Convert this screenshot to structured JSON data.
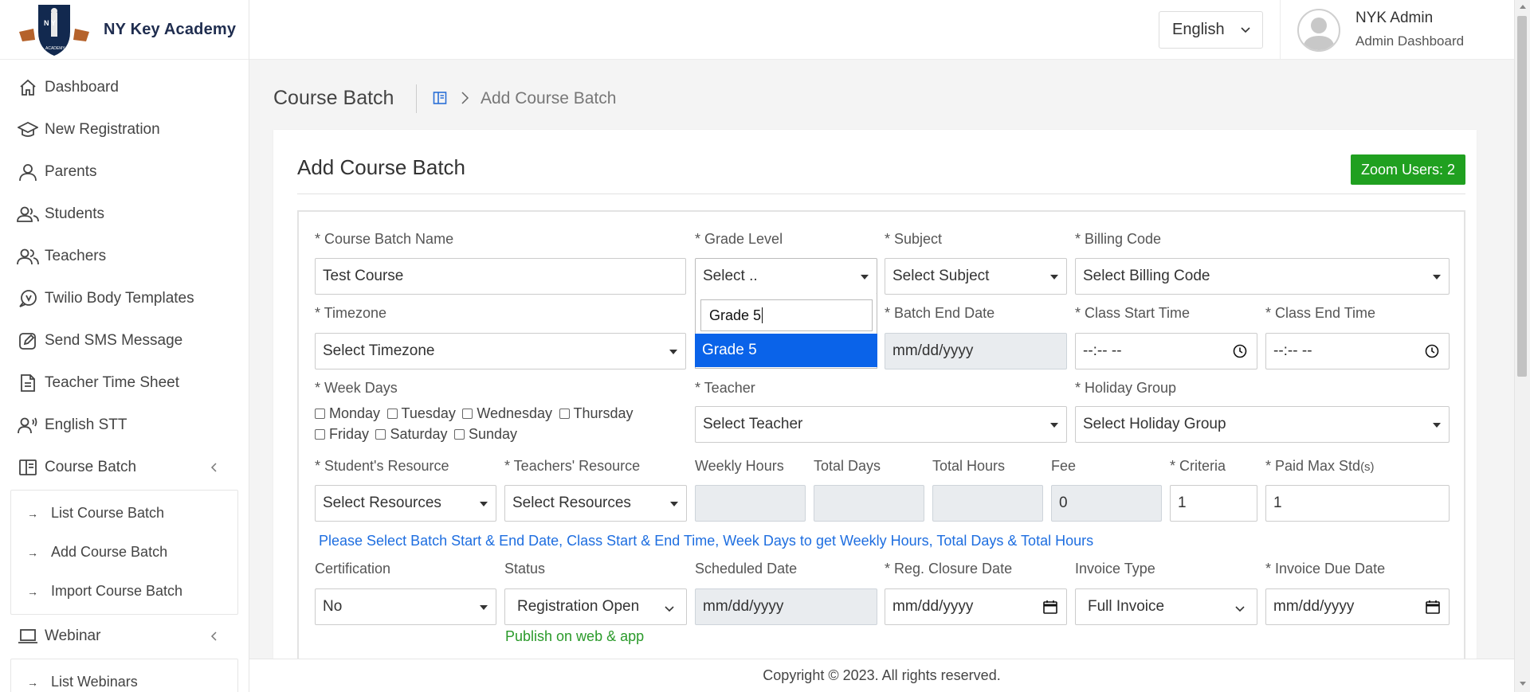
{
  "brand": {
    "name": "NY Key Academy",
    "logo_letters": "N Y",
    "logo_ribbon": "ACADEMY"
  },
  "sidebar": {
    "items": [
      {
        "label": "Dashboard",
        "icon": "home-icon"
      },
      {
        "label": "New Registration",
        "icon": "graduation-cap-icon"
      },
      {
        "label": "Parents",
        "icon": "user-icon"
      },
      {
        "label": "Students",
        "icon": "users-icon"
      },
      {
        "label": "Teachers",
        "icon": "users-icon"
      },
      {
        "label": "Twilio Body Templates",
        "icon": "chat-bubble-icon"
      },
      {
        "label": "Send SMS Message",
        "icon": "edit-icon"
      },
      {
        "label": "Teacher Time Sheet",
        "icon": "document-icon"
      },
      {
        "label": "English STT",
        "icon": "speaking-user-icon"
      },
      {
        "label": "Course Batch",
        "icon": "book-icon"
      }
    ],
    "course_batch_sub": [
      "List Course Batch",
      "Add Course Batch",
      "Import Course Batch"
    ],
    "webinar": {
      "label": "Webinar",
      "icon": "laptop-icon"
    },
    "webinar_sub": [
      "List Webinars"
    ]
  },
  "topbar": {
    "language": "English",
    "user_name": "NYK Admin",
    "user_role": "Admin Dashboard"
  },
  "breadcrumb": {
    "title": "Course Batch",
    "current": "Add Course Batch"
  },
  "card": {
    "title": "Add Course Batch",
    "zoom_badge": "Zoom Users: 2"
  },
  "form": {
    "labels": {
      "batch_name": "* Course Batch Name",
      "grade_level": "* Grade Level",
      "subject": "* Subject",
      "billing_code": "* Billing Code",
      "timezone": "* Timezone",
      "batch_end_date": "* Batch End Date",
      "class_start_time": "* Class Start Time",
      "class_end_time": "* Class End Time",
      "week_days": "* Week Days",
      "teacher": "* Teacher",
      "holiday_group": "* Holiday Group",
      "students_resource": "* Student's Resource",
      "teachers_resource": "* Teachers' Resource",
      "weekly_hours": "Weekly Hours",
      "total_days": "Total Days",
      "total_hours": "Total Hours",
      "fee": "Fee",
      "criteria": "* Criteria",
      "paid_max_std": "* Paid Max Std",
      "paid_max_std_suffix": "(s)",
      "certification": "Certification",
      "status": "Status",
      "scheduled_date": "Scheduled Date",
      "reg_closure_date": "* Reg. Closure Date",
      "invoice_type": "Invoice Type",
      "invoice_due_date": "* Invoice Due Date"
    },
    "values": {
      "batch_name": "Test Course",
      "grade_level": "Select ..",
      "grade_search": "Grade 5",
      "grade_option": "Grade 5",
      "subject": "Select Subject",
      "billing_code": "Select Billing Code",
      "timezone": "Select Timezone",
      "batch_end_date": "mm/dd/yyyy",
      "class_start_time": "--:-- --",
      "class_end_time": "--:-- --",
      "teacher": "Select Teacher",
      "holiday_group": "Select Holiday Group",
      "students_resource": "Select Resources",
      "teachers_resource": "Select Resources",
      "weekly_hours": "",
      "total_days": "",
      "total_hours": "",
      "fee": "0",
      "criteria": "1",
      "paid_max_std": "1",
      "certification": "No",
      "status": "Registration Open",
      "scheduled_date": "mm/dd/yyyy",
      "reg_closure_date": "mm/dd/yyyy",
      "invoice_type": "Full Invoice",
      "invoice_due_date": "mm/dd/yyyy"
    },
    "week_days": [
      "Monday",
      "Tuesday",
      "Wednesday",
      "Thursday",
      "Friday",
      "Saturday",
      "Sunday"
    ],
    "info_text": "Please Select Batch Start & End Date, Class Start & End Time, Week Days to get Weekly Hours, Total Days & Total Hours",
    "status_note": "Publish on web & app"
  },
  "footer": "Copyright © 2023. All rights reserved.",
  "colors": {
    "accent_blue": "#0a63e9",
    "badge_green": "#20a020",
    "brand_navy": "#1f2d4f",
    "note_green": "#2a9a2a"
  }
}
